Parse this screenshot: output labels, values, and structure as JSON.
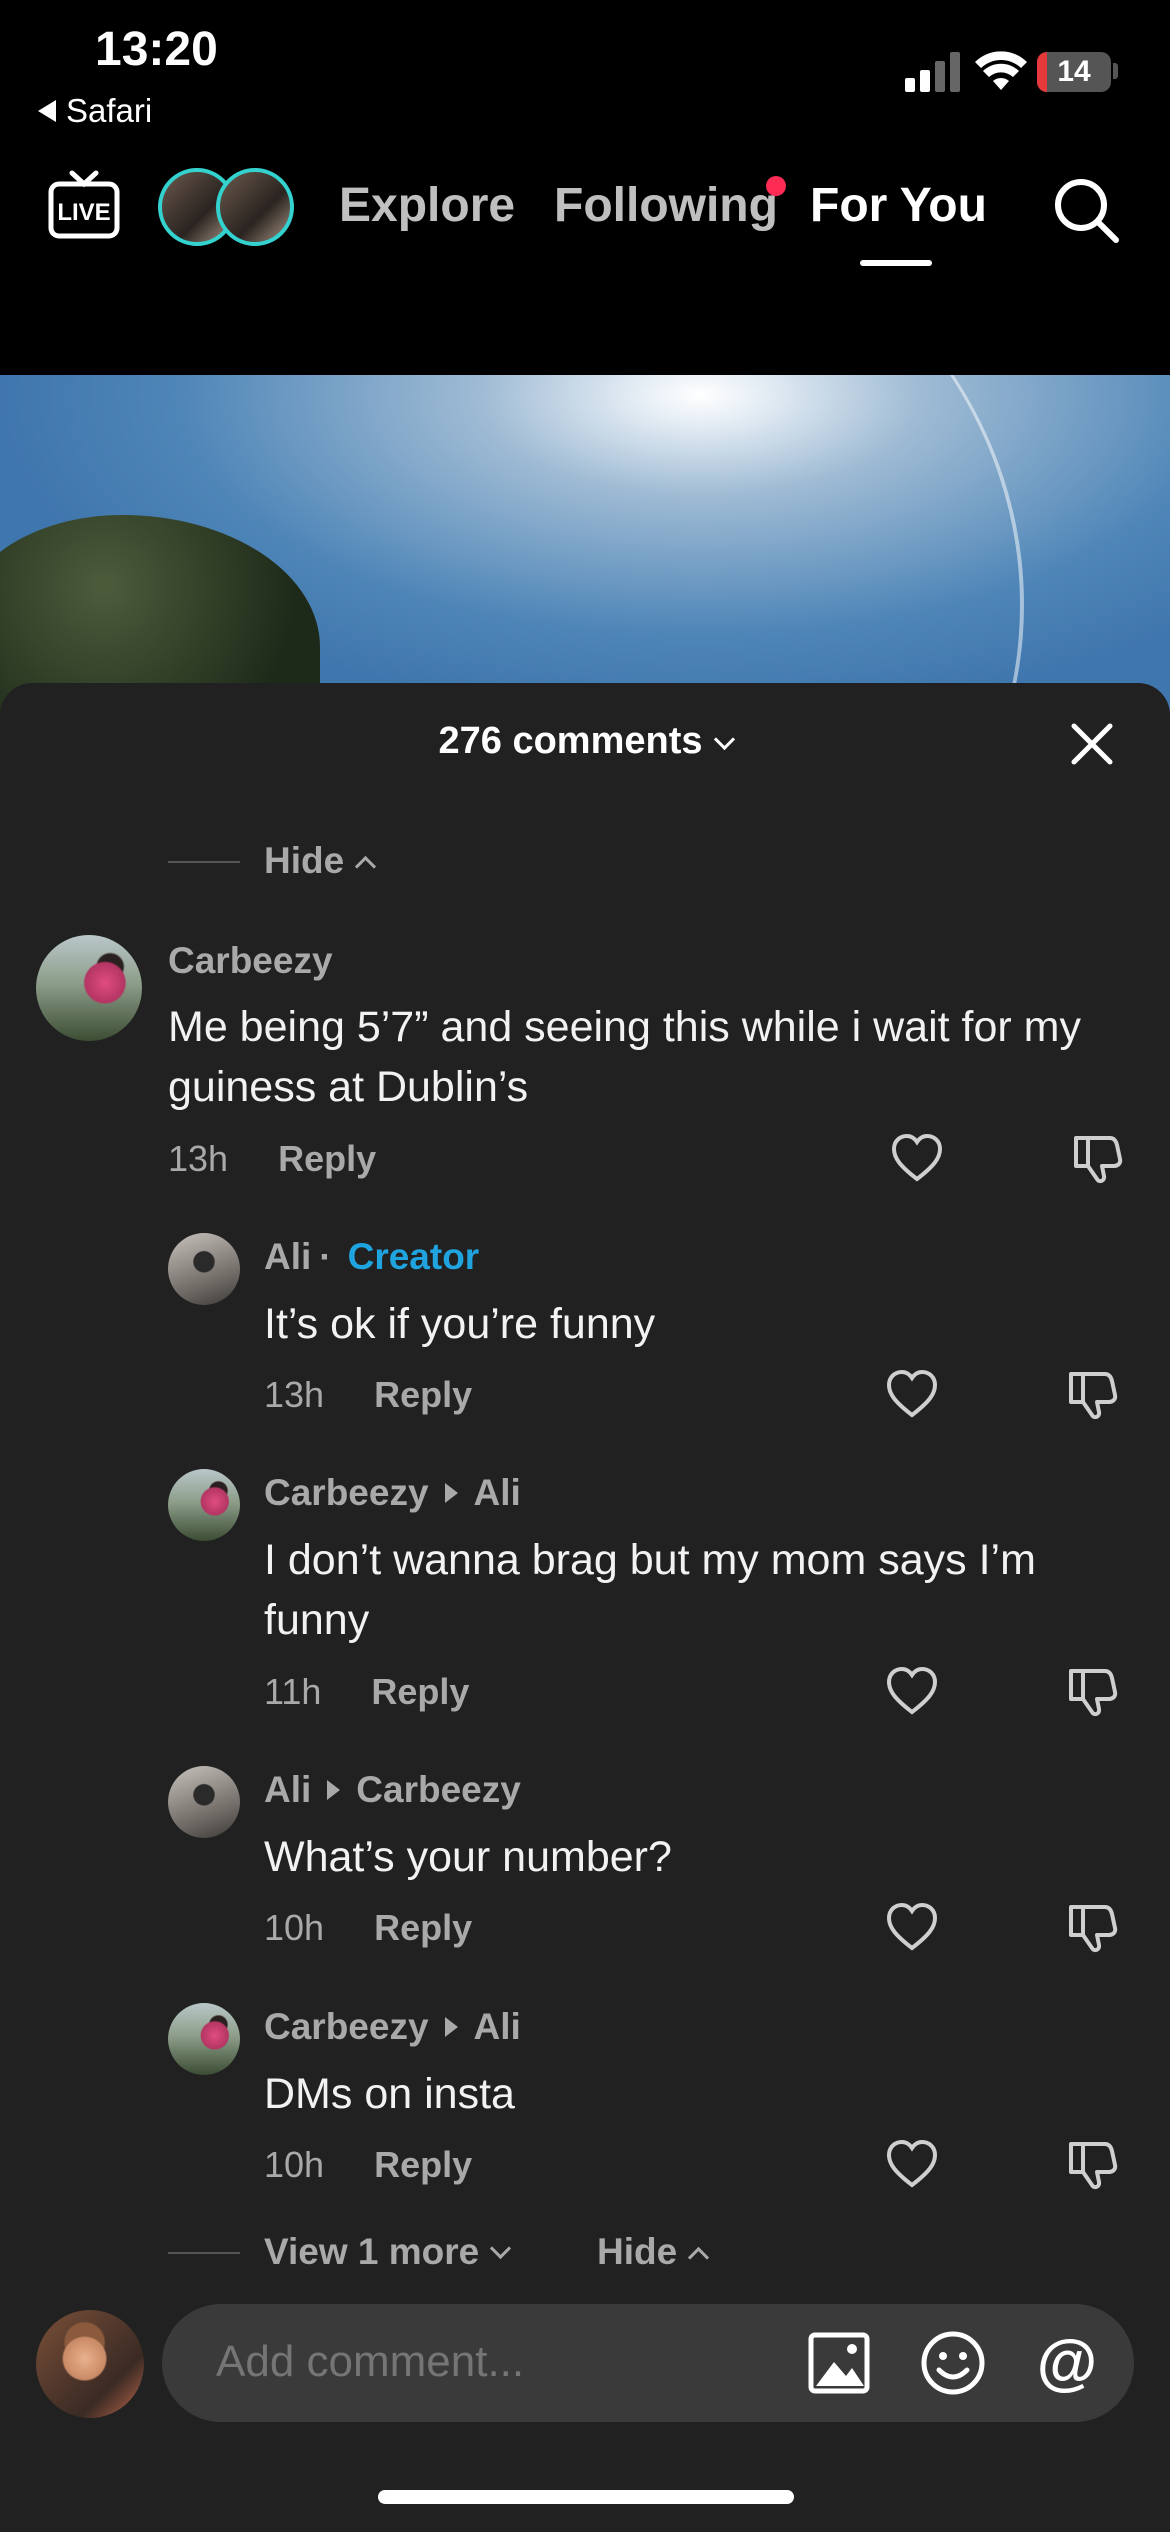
{
  "status": {
    "time": "13:20",
    "back_app": "Safari",
    "battery": "14",
    "battery_fraction": 0.14
  },
  "nav": {
    "live_label": "LIVE",
    "tabs": [
      "Explore",
      "Following",
      "For You"
    ],
    "active_tab": "For You",
    "following_has_dot": true
  },
  "sheet": {
    "title": "276 comments"
  },
  "hide_label": "Hide",
  "comments": [
    {
      "user": "Carbeezy",
      "text": "Me being 5’7” and seeing this while i wait for my guiness at Dublin’s",
      "time": "13h",
      "reply": "Reply"
    }
  ],
  "replies": [
    {
      "user": "Ali",
      "badge": "Creator",
      "text": "It’s ok if you’re funny",
      "time": "13h",
      "reply": "Reply"
    },
    {
      "user": "Carbeezy",
      "to": "Ali",
      "text": "I don’t wanna brag but my mom says I’m funny",
      "time": "11h",
      "reply": "Reply"
    },
    {
      "user": "Ali",
      "to": "Carbeezy",
      "text": "What’s your number?",
      "time": "10h",
      "reply": "Reply"
    },
    {
      "user": "Carbeezy",
      "to": "Ali",
      "text": "DMs on insta",
      "time": "10h",
      "reply": "Reply"
    }
  ],
  "view_more_label": "View 1 more",
  "input": {
    "placeholder": "Add comment..."
  },
  "colors": {
    "accent_creator": "#1fa4e0",
    "notification_dot": "#fe2c55",
    "battery_low": "#e5393b",
    "sheet_bg": "#212121"
  }
}
